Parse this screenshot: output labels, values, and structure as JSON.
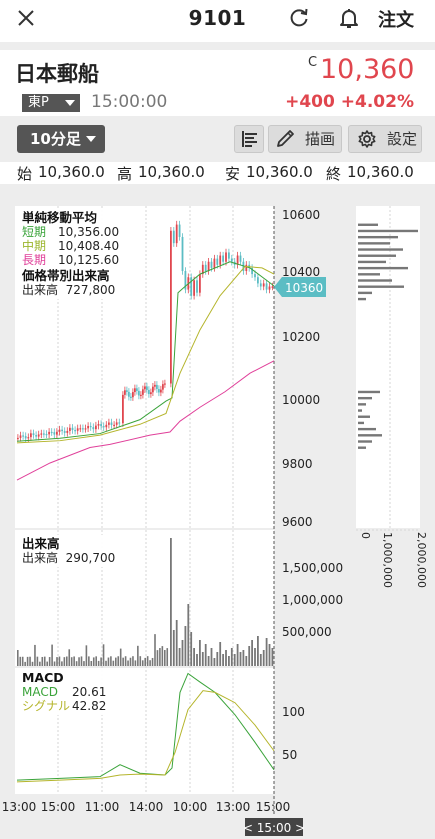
{
  "header": {
    "title": "9101",
    "order_label": "注文",
    "icons": [
      "close-icon",
      "refresh-icon",
      "bell-icon"
    ]
  },
  "stock": {
    "name": "日本郵船",
    "market": "東P",
    "time": "15:00:00",
    "price_flag": "C",
    "price": "10,360",
    "change": "+400",
    "change_pct": "+4.02%",
    "up_color": "#e0464e"
  },
  "controls": {
    "interval": "10分足",
    "draw_label": "描画",
    "settings_label": "設定"
  },
  "ohlc": {
    "open_label": "始",
    "open": "10,360.0",
    "high_label": "高",
    "high": "10,360.0",
    "low_label": "安",
    "low": "10,360.0",
    "close_label": "終",
    "close": "10,360.0"
  },
  "legend_price": {
    "title": "単純移動平均",
    "short_label": "短期",
    "short_value": "10,356.00",
    "short_color": "#3aa33a",
    "mid_label": "中期",
    "mid_value": "10,408.40",
    "mid_color": "#9bb52c",
    "long_label": "長期",
    "long_value": "10,125.60",
    "long_color": "#e0409a",
    "vp_title": "価格帯別出来高",
    "vp_label": "出来高",
    "vp_value": "727,800"
  },
  "legend_volume": {
    "title": "出来高",
    "label": "出来高",
    "value": "290,700"
  },
  "legend_macd": {
    "title": "MACD",
    "macd_label": "MACD",
    "macd_value": "20.61",
    "macd_color": "#3aa33a",
    "signal_label": "シグナル",
    "signal_value": "42.82",
    "signal_color": "#b5b52c"
  },
  "chart_data": [
    {
      "type": "candlestick",
      "y_ticks": [
        "10600",
        "10400",
        "10200",
        "10000",
        "9800",
        "9600"
      ],
      "ylim": [
        9600,
        10600
      ],
      "last_price_tag": "10360",
      "x_ticks": [
        "13:00",
        "15:00",
        "11:00",
        "14:00",
        "10:00",
        "13:00",
        "15:00"
      ],
      "cursor_label": "< 15:00 >"
    },
    {
      "type": "bar",
      "title": "価格帯別出来高",
      "x_ticks": [
        "0",
        "1,000,000",
        "2,000,000"
      ]
    },
    {
      "type": "bar",
      "title": "出来高",
      "y_ticks": [
        "1,500,000",
        "1,000,000",
        "500,000"
      ]
    },
    {
      "type": "line",
      "title": "MACD",
      "y_ticks": [
        "100",
        "50"
      ]
    }
  ]
}
